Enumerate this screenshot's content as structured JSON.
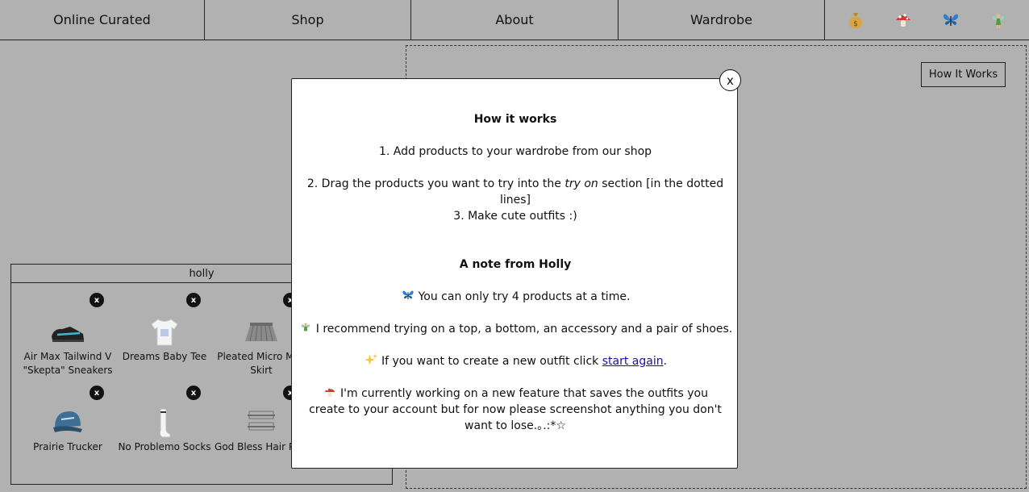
{
  "nav": {
    "items": [
      "Online Curated",
      "Shop",
      "About",
      "Wardrobe"
    ],
    "icons": [
      "money-bag-icon",
      "mushroom-icon",
      "butterfly-icon",
      "fairy-icon"
    ]
  },
  "tryon": {
    "how_button": "How It Works"
  },
  "wardrobe": {
    "title": "holly",
    "remove_label": "x",
    "items": [
      {
        "name": "Air Max Tailwind V \"Skepta\" Sneakers",
        "icon": "sneaker-icon"
      },
      {
        "name": "Dreams Baby Tee",
        "icon": "tshirt-icon"
      },
      {
        "name": "Pleated Micro Mini Skirt",
        "icon": "skirt-icon"
      },
      {
        "name": "Prairie Trucker",
        "icon": "cap-icon"
      },
      {
        "name": "No Problemo Socks",
        "icon": "socks-icon"
      },
      {
        "name": "God Bless Hair Pins",
        "icon": "hairpins-icon"
      }
    ]
  },
  "modal": {
    "close_label": "x",
    "heading": "How it works",
    "step1": "1. Add products to your wardrobe from our shop",
    "step2_pre": "2. Drag the products you want to try into the ",
    "step2_em": "try on",
    "step2_post": " section [in the dotted lines]",
    "step3": "3. Make cute outfits :)",
    "note_heading": "A note from Holly",
    "note1": "You can only try 4 products at a time.",
    "note2": "I recommend trying on a top, a bottom, an accessory and a pair of shoes.",
    "note3_pre": "If you want to create a new outfit click ",
    "note3_link": "start again",
    "note3_post": ".",
    "note4": "I'm currently working on a new feature that saves the outfits you create to your account but for now please screenshot anything you don't want to lose.｡.:*☆"
  }
}
